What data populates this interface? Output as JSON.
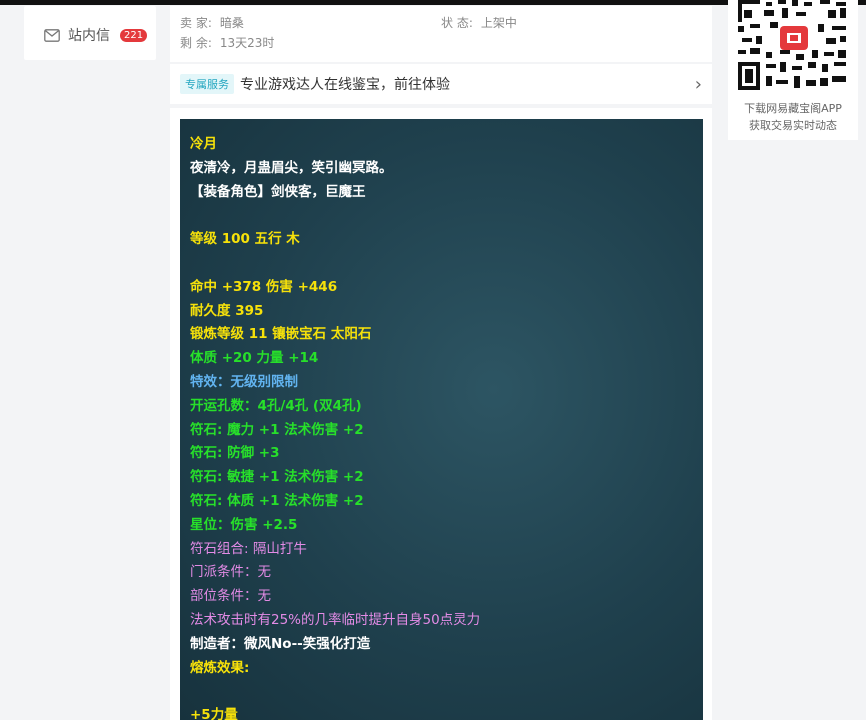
{
  "nav": {
    "messages_label": "站内信",
    "messages_count": "221"
  },
  "seller": {
    "seller_label": "卖 家:",
    "seller_value": "暗桑",
    "remaining_label": "剩 余:",
    "remaining_value": "13天23时",
    "status_label": "状 态:",
    "status_value": "上架中"
  },
  "banner": {
    "tag": "专属服务",
    "text": "专业游戏达人在线鉴宝，前往体验",
    "arrow": "›"
  },
  "equipment": {
    "lines": [
      {
        "text": "冷月",
        "color": "yellow"
      },
      {
        "text": "夜清冷，月蛊眉尖，笑引幽冥路。",
        "color": "white"
      },
      {
        "text": "【装备角色】剑侠客，巨魔王",
        "color": "white"
      },
      {
        "text": "",
        "color": "white"
      },
      {
        "text": "等级 100 五行 木",
        "color": "yellow"
      },
      {
        "text": "",
        "color": "white"
      },
      {
        "text": "命中 +378 伤害 +446",
        "color": "yellow"
      },
      {
        "text": "耐久度 395",
        "color": "yellow"
      },
      {
        "text": "锻炼等级 11 镶嵌宝石 太阳石",
        "color": "yellow"
      },
      {
        "text": "体质 +20 力量 +14",
        "color": "green"
      },
      {
        "text": "特效：无级别限制",
        "color": "blue"
      },
      {
        "text": "开运孔数：4孔/4孔 (双4孔)",
        "color": "green"
      },
      {
        "text": "符石: 魔力 +1 法术伤害 +2",
        "color": "green"
      },
      {
        "text": "符石: 防御 +3",
        "color": "green"
      },
      {
        "text": "符石: 敏捷 +1 法术伤害 +2",
        "color": "green"
      },
      {
        "text": "符石: 体质 +1 法术伤害 +2",
        "color": "green"
      },
      {
        "text": "星位：伤害 +2.5",
        "color": "green"
      },
      {
        "text": "符石组合: 隔山打牛",
        "color": "pink"
      },
      {
        "text": "门派条件：无",
        "color": "pink"
      },
      {
        "text": "部位条件：无",
        "color": "pink"
      },
      {
        "text": "法术攻击时有25%的几率临时提升自身50点灵力",
        "color": "pink"
      },
      {
        "text": "制造者：微风No--笑强化打造",
        "color": "white"
      },
      {
        "text": "熔炼效果:",
        "color": "yellow"
      },
      {
        "text": "",
        "color": "white"
      },
      {
        "text": "+5力量",
        "color": "yellow"
      }
    ]
  },
  "qr": {
    "line1": "下载网易藏宝阁APP",
    "line2": "获取交易实时动态"
  },
  "colors": {
    "yellow": "#f6e10a",
    "white": "#ffffff",
    "green": "#27e02a",
    "blue": "#62b4f0",
    "pink": "#e38be6",
    "badge": "#e4393c"
  }
}
